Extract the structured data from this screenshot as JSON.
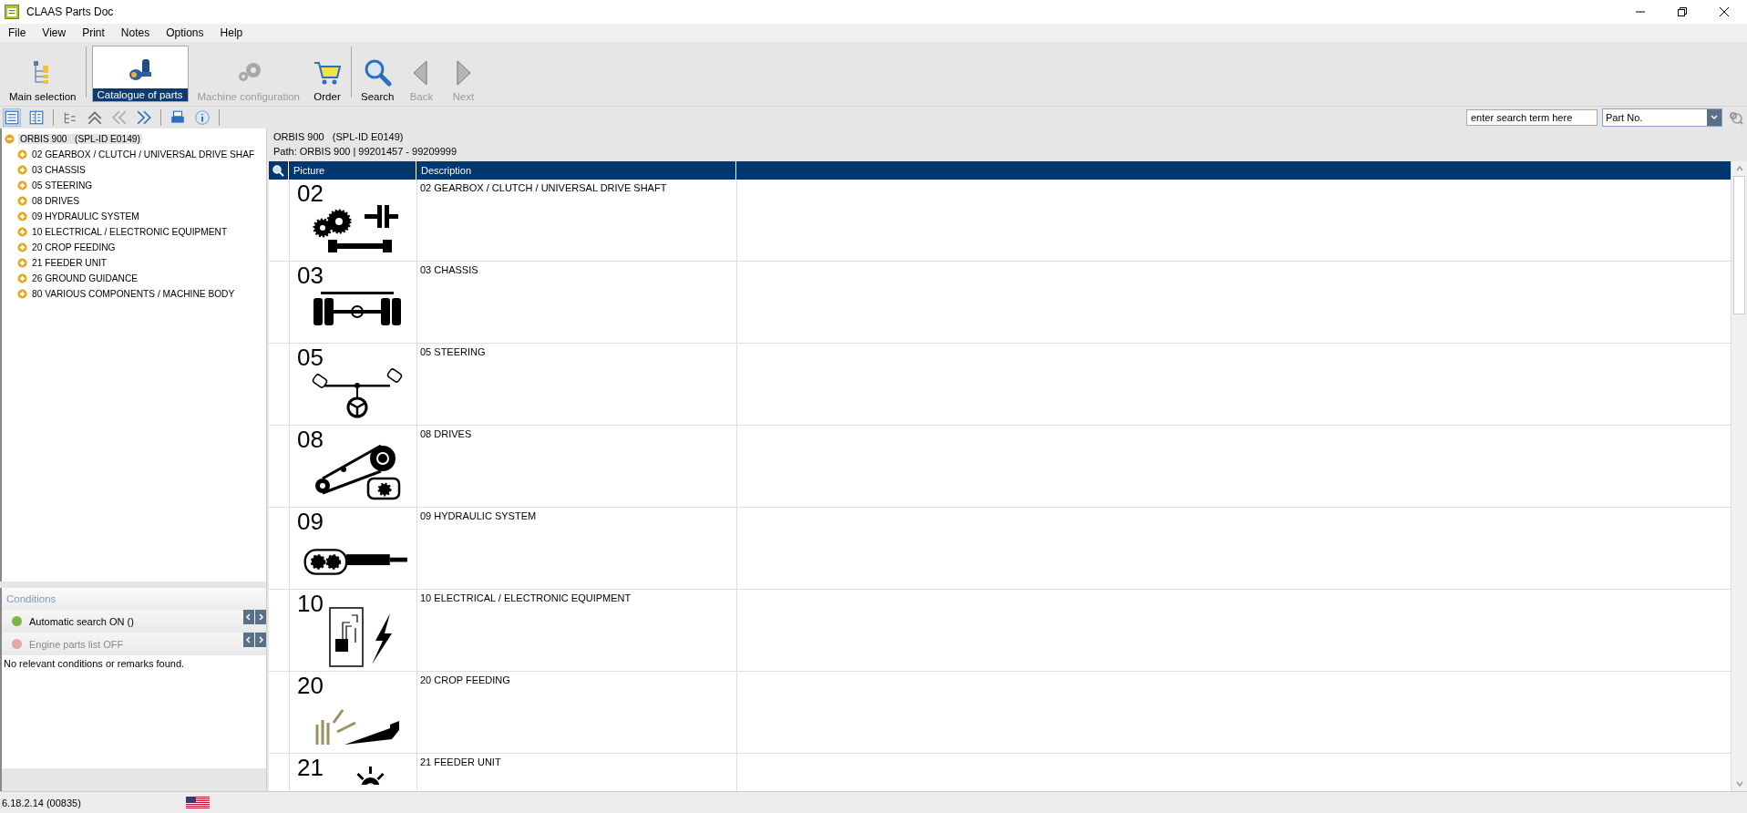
{
  "window": {
    "title": "CLAAS Parts Doc"
  },
  "menu": [
    "File",
    "View",
    "Print",
    "Notes",
    "Options",
    "Help"
  ],
  "toolbar": [
    {
      "kind": "tree",
      "label": "Main selection",
      "selected": false,
      "disabled": false
    },
    {
      "kind": "parts",
      "label": "Catalogue of parts",
      "selected": true,
      "disabled": false
    },
    {
      "kind": "gears",
      "label": "Machine configuration",
      "selected": false,
      "disabled": true
    },
    {
      "kind": "cart",
      "label": "Order",
      "selected": false,
      "disabled": false
    },
    {
      "kind": "search",
      "label": "Search",
      "selected": false,
      "disabled": false
    },
    {
      "kind": "back",
      "label": "Back",
      "selected": false,
      "disabled": true
    },
    {
      "kind": "next",
      "label": "Next",
      "selected": false,
      "disabled": true
    }
  ],
  "search": {
    "placeholder": "enter search term here",
    "field": "Part No."
  },
  "tree": {
    "label": "ORBIS 900   (SPL-ID E0149)",
    "expanded": true,
    "selected": true,
    "children": [
      {
        "label": "02 GEARBOX / CLUTCH / UNIVERSAL DRIVE SHAF",
        "expanded": false,
        "selected": false
      },
      {
        "label": "03 CHASSIS",
        "expanded": false,
        "selected": false
      },
      {
        "label": "05 STEERING",
        "expanded": false,
        "selected": false
      },
      {
        "label": "08 DRIVES",
        "expanded": false,
        "selected": false
      },
      {
        "label": "09 HYDRAULIC SYSTEM",
        "expanded": false,
        "selected": false
      },
      {
        "label": "10 ELECTRICAL / ELECTRONIC EQUIPMENT",
        "expanded": false,
        "selected": false
      },
      {
        "label": "20 CROP FEEDING",
        "expanded": false,
        "selected": false
      },
      {
        "label": "21 FEEDER UNIT",
        "expanded": false,
        "selected": false
      },
      {
        "label": "26 GROUND GUIDANCE",
        "expanded": false,
        "selected": false
      },
      {
        "label": "80 VARIOUS COMPONENTS / MACHINE BODY",
        "expanded": false,
        "selected": false
      }
    ]
  },
  "conditions": {
    "title": "Conditions",
    "items": [
      {
        "label": "Automatic search ON   ()",
        "on": true,
        "color": "#7ab648"
      },
      {
        "label": "Engine parts list OFF",
        "on": false,
        "color": "#e4a8a8"
      }
    ],
    "message": "No relevant conditions or remarks found."
  },
  "header": {
    "title": "ORBIS 900   (SPL-ID E0149)",
    "path": "Path: ORBIS 900 | 99201457 - 99209999"
  },
  "table": {
    "columns": [
      "Picture",
      "Description"
    ],
    "rows": [
      {
        "number": "02",
        "kind": "gearbox",
        "description": "02 GEARBOX / CLUTCH / UNIVERSAL DRIVE SHAFT"
      },
      {
        "number": "03",
        "kind": "chassis",
        "description": "03 CHASSIS"
      },
      {
        "number": "05",
        "kind": "steering",
        "description": "05 STEERING"
      },
      {
        "number": "08",
        "kind": "drives",
        "description": "08 DRIVES"
      },
      {
        "number": "09",
        "kind": "hydraulic",
        "description": "09 HYDRAULIC SYSTEM"
      },
      {
        "number": "10",
        "kind": "electrical",
        "description": "10 ELECTRICAL / ELECTRONIC EQUIPMENT"
      },
      {
        "number": "20",
        "kind": "crop",
        "description": "20 CROP FEEDING"
      },
      {
        "number": "21",
        "kind": "feeder",
        "description": "21 FEEDER UNIT"
      }
    ]
  },
  "status_bar": {
    "version": "6.18.2.14 (00835)"
  }
}
